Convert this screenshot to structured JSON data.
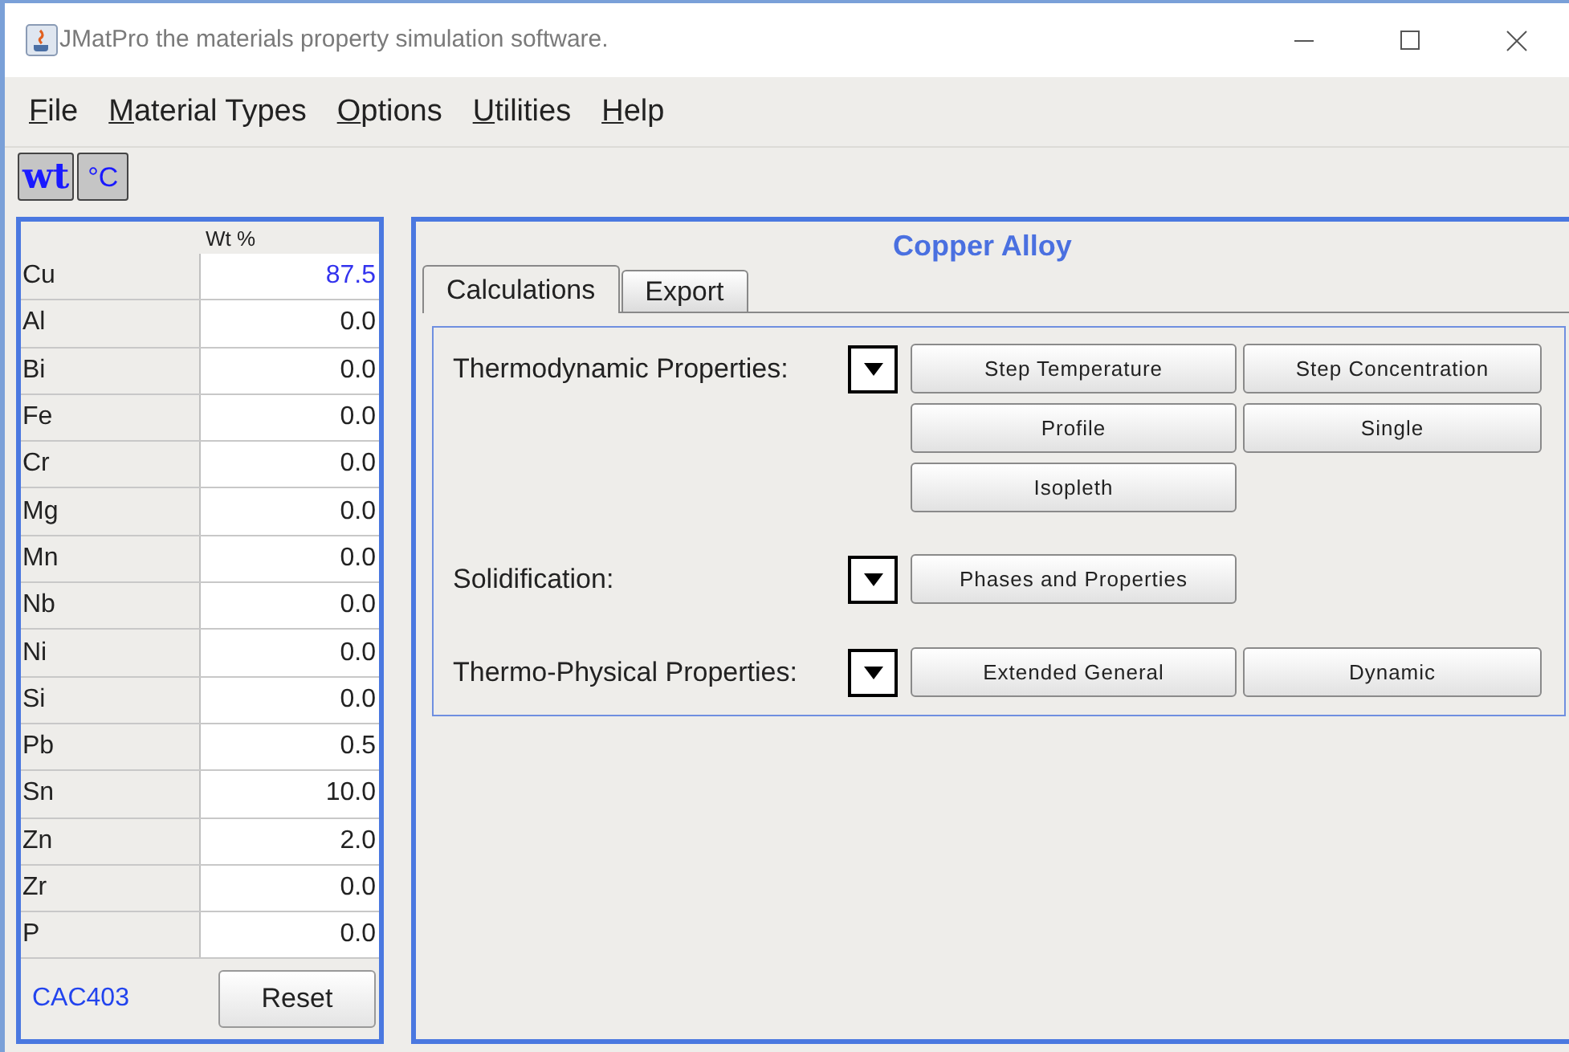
{
  "window": {
    "title": "JMatPro the materials property simulation software."
  },
  "menu": [
    {
      "key": "F",
      "rest": "ile"
    },
    {
      "key": "M",
      "rest": "aterial Types"
    },
    {
      "key": "O",
      "rest": "ptions"
    },
    {
      "key": "U",
      "rest": "tilities"
    },
    {
      "key": "H",
      "rest": "elp"
    }
  ],
  "toolbar": [
    {
      "label": "wt",
      "kind": "weight"
    },
    {
      "label": "°C",
      "kind": "temperature"
    }
  ],
  "composition": {
    "header": "Wt %",
    "rows": [
      {
        "element": "Cu",
        "value": "87.5",
        "highlighted": true
      },
      {
        "element": "Al",
        "value": "0.0",
        "highlighted": false
      },
      {
        "element": "Bi",
        "value": "0.0",
        "highlighted": false
      },
      {
        "element": "Fe",
        "value": "0.0",
        "highlighted": false
      },
      {
        "element": "Cr",
        "value": "0.0",
        "highlighted": false
      },
      {
        "element": "Mg",
        "value": "0.0",
        "highlighted": false
      },
      {
        "element": "Mn",
        "value": "0.0",
        "highlighted": false
      },
      {
        "element": "Nb",
        "value": "0.0",
        "highlighted": false
      },
      {
        "element": "Ni",
        "value": "0.0",
        "highlighted": false
      },
      {
        "element": "Si",
        "value": "0.0",
        "highlighted": false
      },
      {
        "element": "Pb",
        "value": "0.5",
        "highlighted": false
      },
      {
        "element": "Sn",
        "value": "10.0",
        "highlighted": false
      },
      {
        "element": "Zn",
        "value": "2.0",
        "highlighted": false
      },
      {
        "element": "Zr",
        "value": "0.0",
        "highlighted": false
      },
      {
        "element": "P",
        "value": "0.0",
        "highlighted": false
      }
    ],
    "alloy_code": "CAC403",
    "reset_button": "Reset"
  },
  "panel": {
    "title": "Copper Alloy",
    "tabs": [
      {
        "label": "Calculations",
        "selected": true
      },
      {
        "label": "Export",
        "selected": false
      }
    ],
    "sections": [
      {
        "label": "Thermodynamic Properties:",
        "buttons": [
          "Step Temperature",
          "Step Concentration",
          "Profile",
          "Single",
          "Isopleth"
        ]
      },
      {
        "label": "Solidification:",
        "buttons": [
          "Phases and Properties"
        ]
      },
      {
        "label": "Thermo-Physical Properties:",
        "buttons": [
          "Extended General",
          "Dynamic"
        ]
      }
    ]
  }
}
